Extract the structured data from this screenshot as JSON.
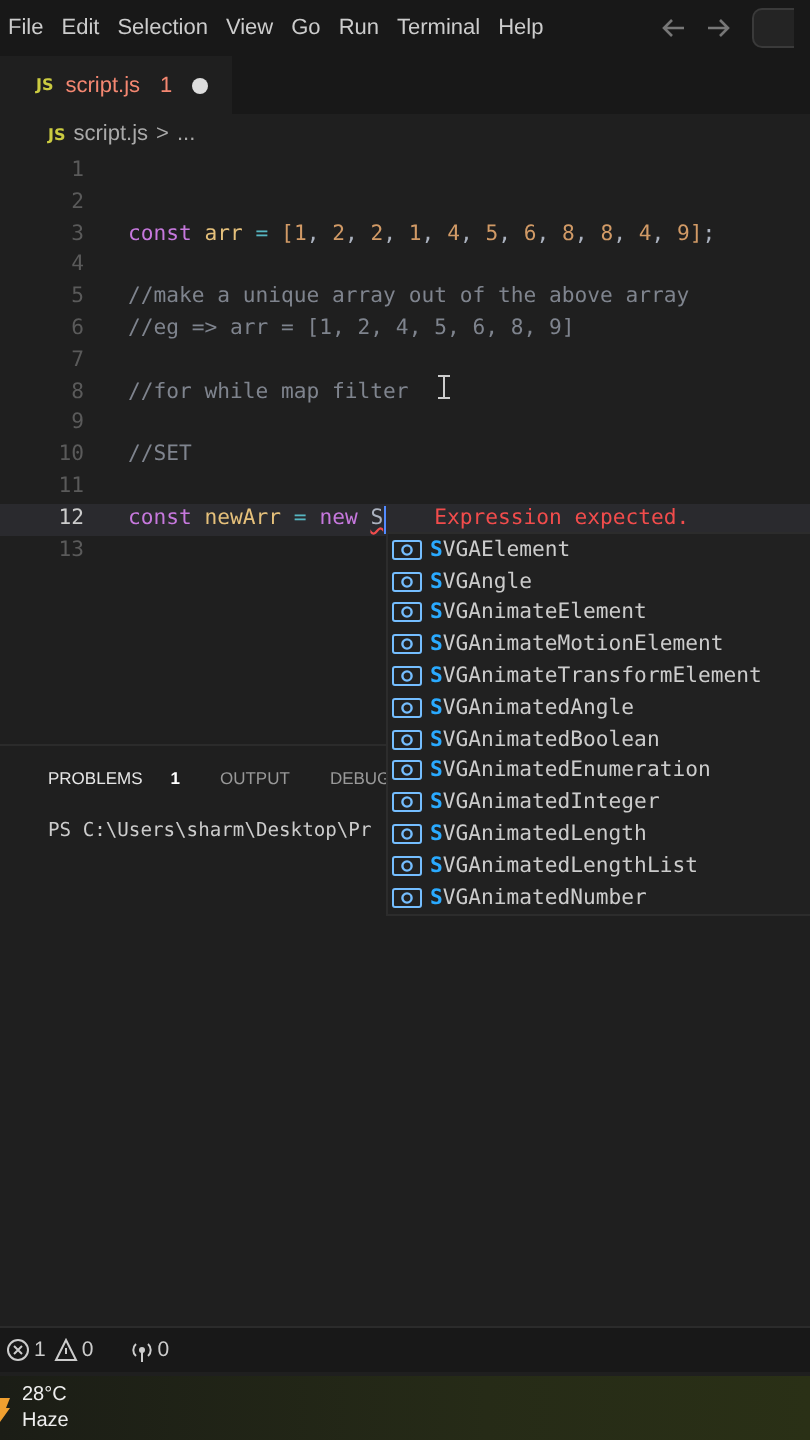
{
  "menu": [
    "File",
    "Edit",
    "Selection",
    "View",
    "Go",
    "Run",
    "Terminal",
    "Help"
  ],
  "tabs": [
    {
      "label": "script.js",
      "badge": "JS",
      "problems": "1",
      "modified": true,
      "selected": true
    }
  ],
  "breadcrumb": {
    "badge": "JS",
    "file": "script.js",
    "separator": ">",
    "rest": "..."
  },
  "lines": [
    {
      "number": "1",
      "current": false
    },
    {
      "number": "2",
      "current": false
    },
    {
      "number": "3",
      "current": false,
      "tokens": [
        {
          "kind": "keyword",
          "text": "const",
          "spaced": true
        },
        {
          "kind": "variable",
          "text": "arr",
          "spaced": true
        },
        {
          "kind": "operator",
          "text": "=",
          "spaced": true
        },
        {
          "kind": "bracket",
          "text": "["
        },
        {
          "kind": "number",
          "text": "1"
        },
        {
          "kind": "plain",
          "text": ",",
          "spaced": true
        },
        {
          "kind": "number",
          "text": "2"
        },
        {
          "kind": "plain",
          "text": ",",
          "spaced": true
        },
        {
          "kind": "number",
          "text": "2"
        },
        {
          "kind": "plain",
          "text": ",",
          "spaced": true
        },
        {
          "kind": "number",
          "text": "1"
        },
        {
          "kind": "plain",
          "text": ",",
          "spaced": true
        },
        {
          "kind": "number",
          "text": "4"
        },
        {
          "kind": "plain",
          "text": ",",
          "spaced": true
        },
        {
          "kind": "number",
          "text": "5"
        },
        {
          "kind": "plain",
          "text": ",",
          "spaced": true
        },
        {
          "kind": "number",
          "text": "6"
        },
        {
          "kind": "plain",
          "text": ",",
          "spaced": true
        },
        {
          "kind": "number",
          "text": "8"
        },
        {
          "kind": "plain",
          "text": ",",
          "spaced": true
        },
        {
          "kind": "number",
          "text": "8"
        },
        {
          "kind": "plain",
          "text": ",",
          "spaced": true
        },
        {
          "kind": "number",
          "text": "4"
        },
        {
          "kind": "plain",
          "text": ",",
          "spaced": true
        },
        {
          "kind": "number",
          "text": "9"
        },
        {
          "kind": "bracket",
          "text": "]"
        },
        {
          "kind": "plain",
          "text": ";"
        }
      ]
    },
    {
      "number": "4",
      "current": false
    },
    {
      "number": "5",
      "current": false,
      "tokens": [
        {
          "kind": "comment",
          "text": "//make a unique array out of the above array"
        }
      ]
    },
    {
      "number": "6",
      "current": false,
      "tokens": [
        {
          "kind": "comment",
          "text": "//eg => arr = [1, 2, 4, 5, 6, 8, 9]"
        }
      ]
    },
    {
      "number": "7",
      "current": false
    },
    {
      "number": "8",
      "current": false,
      "tokens": [
        {
          "kind": "comment",
          "text": "//for while map filter"
        }
      ]
    },
    {
      "number": "9",
      "current": false
    },
    {
      "number": "10",
      "current": false,
      "tokens": [
        {
          "kind": "comment",
          "text": "//SET"
        }
      ]
    },
    {
      "number": "11",
      "current": false
    },
    {
      "number": "12",
      "current": true,
      "error": "Expression expected.",
      "tokens": [
        {
          "kind": "keyword",
          "text": "const",
          "spaced": true
        },
        {
          "kind": "variable",
          "text": "newArr",
          "spaced": true
        },
        {
          "kind": "operator",
          "text": "=",
          "spaced": true
        },
        {
          "kind": "keyword",
          "text": "new",
          "spaced": true
        },
        {
          "kind": "typing",
          "text": "S"
        }
      ]
    },
    {
      "number": "13",
      "current": false
    }
  ],
  "suggestions": [
    "**S**VGAElement",
    "**S**VGAngle",
    "**S**VGAnimateElement",
    "**S**VGAnimateMotionElement",
    "**S**VGAnimateTransformElement",
    "**S**VGAnimatedAngle",
    "**S**VGAnimatedBoolean",
    "**S**VGAnimatedEnumeration",
    "**S**VGAnimatedInteger",
    "**S**VGAnimatedLength",
    "**S**VGAnimatedLengthList",
    "**S**VGAnimatedNumber"
  ],
  "panel": {
    "tabs": [
      {
        "label": "PROBLEMS",
        "count": "1",
        "selected": true
      },
      {
        "label": "OUTPUT",
        "selected": false
      },
      {
        "label": "DEBUG",
        "selected": false
      }
    ],
    "terminal": "PS C:\\Users\\sharm\\Desktop\\Pr"
  },
  "status_bar": {
    "errors": "1",
    "warnings": "0",
    "ports": "0"
  },
  "taskbar": {
    "temperature": "28°C",
    "condition": "Haze"
  }
}
